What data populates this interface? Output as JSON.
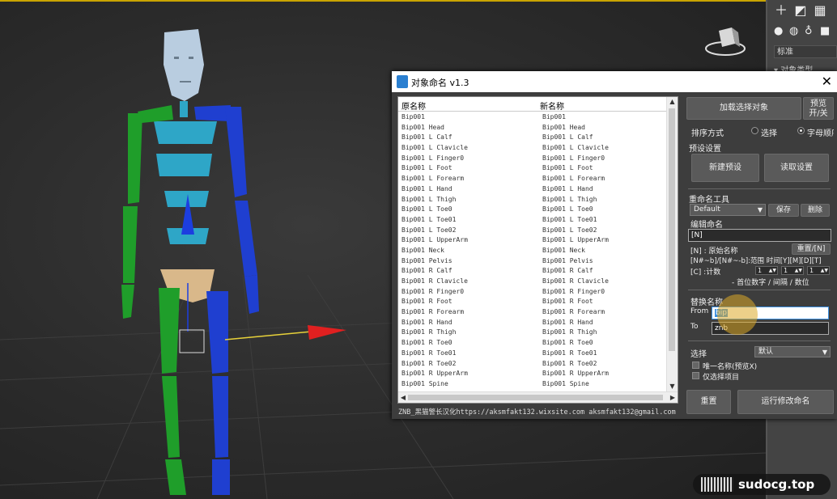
{
  "app": {
    "right_panel_field": "标准",
    "right_panel_section": "▾ 对象类型"
  },
  "watermark": {
    "text": "sudocg.top"
  },
  "dialog": {
    "title": "对象命名 v1.3",
    "columns": {
      "original": "原名称",
      "new": "新名称"
    },
    "rows": [
      {
        "original": "Bip001",
        "new": "Bip001"
      },
      {
        "original": "Bip001 Head",
        "new": "Bip001 Head"
      },
      {
        "original": "Bip001 L Calf",
        "new": "Bip001 L Calf"
      },
      {
        "original": "Bip001 L Clavicle",
        "new": "Bip001 L Clavicle"
      },
      {
        "original": "Bip001 L Finger0",
        "new": "Bip001 L Finger0"
      },
      {
        "original": "Bip001 L Foot",
        "new": "Bip001 L Foot"
      },
      {
        "original": "Bip001 L Forearm",
        "new": "Bip001 L Forearm"
      },
      {
        "original": "Bip001 L Hand",
        "new": "Bip001 L Hand"
      },
      {
        "original": "Bip001 L Thigh",
        "new": "Bip001 L Thigh"
      },
      {
        "original": "Bip001 L Toe0",
        "new": "Bip001 L Toe0"
      },
      {
        "original": "Bip001 L Toe01",
        "new": "Bip001 L Toe01"
      },
      {
        "original": "Bip001 L Toe02",
        "new": "Bip001 L Toe02"
      },
      {
        "original": "Bip001 L UpperArm",
        "new": "Bip001 L UpperArm"
      },
      {
        "original": "Bip001 Neck",
        "new": "Bip001 Neck"
      },
      {
        "original": "Bip001 Pelvis",
        "new": "Bip001 Pelvis"
      },
      {
        "original": "Bip001 R Calf",
        "new": "Bip001 R Calf"
      },
      {
        "original": "Bip001 R Clavicle",
        "new": "Bip001 R Clavicle"
      },
      {
        "original": "Bip001 R Finger0",
        "new": "Bip001 R Finger0"
      },
      {
        "original": "Bip001 R Foot",
        "new": "Bip001 R Foot"
      },
      {
        "original": "Bip001 R Forearm",
        "new": "Bip001 R Forearm"
      },
      {
        "original": "Bip001 R Hand",
        "new": "Bip001 R Hand"
      },
      {
        "original": "Bip001 R Thigh",
        "new": "Bip001 R Thigh"
      },
      {
        "original": "Bip001 R Toe0",
        "new": "Bip001 R Toe0"
      },
      {
        "original": "Bip001 R Toe01",
        "new": "Bip001 R Toe01"
      },
      {
        "original": "Bip001 R Toe02",
        "new": "Bip001 R Toe02"
      },
      {
        "original": "Bip001 R UpperArm",
        "new": "Bip001 R UpperArm"
      },
      {
        "original": "Bip001 Spine",
        "new": "Bip001 Spine"
      }
    ],
    "footer": "ZNB_黑猫警长汉化https://aksmfakt132.wixsite.com   aksmfakt132@gmail.com",
    "load_selection_button": "加载选择对象",
    "preview_toggle_button": {
      "line1": "预览",
      "line2": "开/关"
    },
    "sort": {
      "label": "排序方式",
      "option_selection": "选择",
      "option_alpha": "字母顺序",
      "selected": "option_alpha"
    },
    "presets": {
      "label": "预设设置",
      "new_button": "新建预设",
      "load_button": "读取设置"
    },
    "rename_tool": {
      "label": "重命名工具",
      "preset_value": "Default",
      "save_button": "保存",
      "delete_button": "删除",
      "edit_label": "编辑命名",
      "edit_value": "[N]",
      "help_line1": "[N] : 原始名称",
      "reset_button": "重置/[N]",
      "help_line2": "[N#~b]/[N#~-b]:范围 时间[Y][M][D][T]",
      "counter_label": "[C] :计数",
      "counter_values": [
        "1",
        "1",
        "1"
      ],
      "counter_legend": "- 首位数字 / 间隔 / 数位"
    },
    "replace": {
      "label": "替换名称",
      "from_label": "From",
      "from_value": "bip",
      "to_label": "To",
      "to_value": "znb"
    },
    "select": {
      "label": "选择",
      "dropdown_value": "默认",
      "unique_label": "唯一名称(预览X)",
      "selected_only_label": "仅选择项目"
    },
    "reset_button": "重置",
    "run_button": "运行修改命名"
  }
}
